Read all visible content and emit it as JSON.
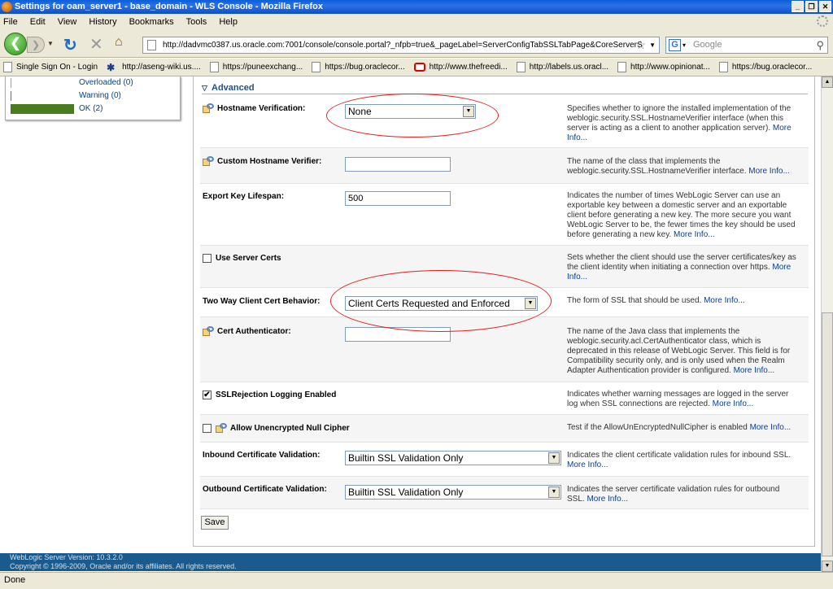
{
  "window": {
    "title": "Settings for oam_server1 - base_domain - WLS Console - Mozilla Firefox"
  },
  "menu": [
    "File",
    "Edit",
    "View",
    "History",
    "Bookmarks",
    "Tools",
    "Help"
  ],
  "nav": {
    "url": "http://dadvmc0387.us.oracle.com:7001/console/console.portal?_nfpb=true&_pageLabel=ServerConfigTabSSLTabPage&CoreServerS",
    "search_placeholder": "Google"
  },
  "bookmarks": [
    {
      "label": "Single Sign On - Login",
      "icon": "page-icon"
    },
    {
      "label": "http://aseng-wiki.us....",
      "icon": "wiki-icon"
    },
    {
      "label": "https://puneexchang...",
      "icon": "page-icon"
    },
    {
      "label": "https://bug.oraclecor...",
      "icon": "page-icon"
    },
    {
      "label": "http://www.thefreedi...",
      "icon": "oracle-icon"
    },
    {
      "label": "http://labels.us.oracl...",
      "icon": "page-icon"
    },
    {
      "label": "http://www.opinionat...",
      "icon": "page-icon"
    },
    {
      "label": "https://bug.oraclecor...",
      "icon": "page-icon"
    }
  ],
  "health": {
    "overloaded": "Overloaded (0)",
    "warning": "Warning (0)",
    "ok": "OK (2)"
  },
  "section": {
    "title": "Advanced"
  },
  "fields": {
    "hostname_verification": {
      "label": "Hostname Verification:",
      "value": "None",
      "desc": "Specifies whether to ignore the installed implementation of the weblogic.security.SSL.HostnameVerifier interface (when this server is acting as a client to another application server).",
      "more": "More Info..."
    },
    "custom_hostname_verifier": {
      "label": "Custom Hostname Verifier:",
      "value": "",
      "desc": "The name of the class that implements the weblogic.security.SSL.HostnameVerifier interface.",
      "more": "More Info..."
    },
    "export_key_lifespan": {
      "label": "Export Key Lifespan:",
      "value": "500",
      "desc": "Indicates the number of times WebLogic Server can use an exportable key between a domestic server and an exportable client before generating a new key. The more secure you want WebLogic Server to be, the fewer times the key should be used before generating a new key.",
      "more": "More Info..."
    },
    "use_server_certs": {
      "label": "Use Server Certs",
      "checked": "",
      "desc": "Sets whether the client should use the server certificates/key as the client identity when initiating a connection over https.",
      "more": "More Info..."
    },
    "two_way_client_cert": {
      "label": "Two Way Client Cert Behavior:",
      "value": "Client Certs Requested and Enforced",
      "desc": "The form of SSL that should be used.",
      "more": "More Info..."
    },
    "cert_authenticator": {
      "label": "Cert Authenticator:",
      "value": "",
      "desc": "The name of the Java class that implements the weblogic.security.acl.CertAuthenticator class, which is deprecated in this release of WebLogic Server. This field is for Compatibility security only, and is only used when the Realm Adapter Authentication provider is configured.",
      "more": "More Info..."
    },
    "ssl_rejection_logging": {
      "label": "SSLRejection Logging Enabled",
      "checked": "✔",
      "desc": "Indicates whether warning messages are logged in the server log when SSL connections are rejected.",
      "more": "More Info..."
    },
    "allow_unencrypted_null_cipher": {
      "label": "Allow Unencrypted Null Cipher",
      "checked": "",
      "desc": "Test if the AllowUnEncryptedNullCipher is enabled",
      "more": "More Info..."
    },
    "inbound_cert_validation": {
      "label": "Inbound Certificate Validation:",
      "value": "Builtin SSL Validation Only",
      "desc": "Indicates the client certificate validation rules for inbound SSL.",
      "more": "More Info..."
    },
    "outbound_cert_validation": {
      "label": "Outbound Certificate Validation:",
      "value": "Builtin SSL Validation Only",
      "desc": "Indicates the server certificate validation rules for outbound SSL.",
      "more": "More Info..."
    }
  },
  "save_label": "Save",
  "footer": {
    "version": "WebLogic Server Version: 10.3.2.0",
    "copyright": "Copyright © 1996-2009, Oracle and/or its affiliates. All rights reserved."
  },
  "status": "Done",
  "colors": {
    "accent": "#1d4e8c",
    "annotation": "#e02020",
    "ok_bar": "#4a7c1f"
  }
}
